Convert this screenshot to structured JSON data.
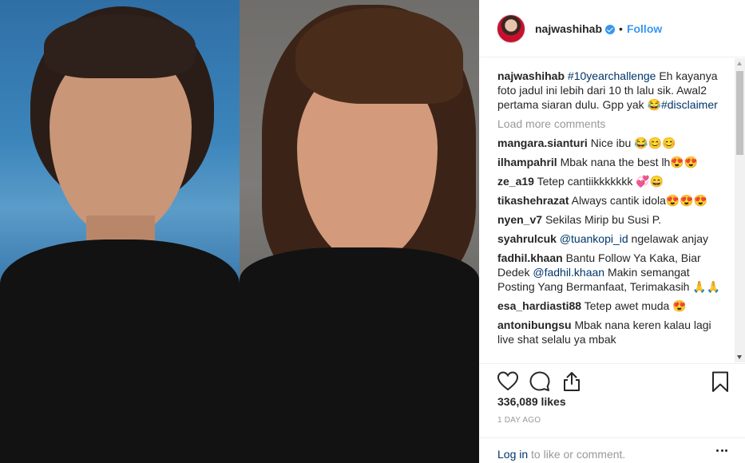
{
  "post": {
    "username": "najwashihab",
    "separator": "•",
    "follow_label": "Follow"
  },
  "caption": {
    "username": "najwashihab",
    "hashtag": "#10yearchallenge",
    "text": "Eh kayanya foto jadul ini lebih dari 10 th lalu sik. Awal2 pertama siaran dulu. Gpp yak 😂",
    "hashtag2": "#disclaimer"
  },
  "load_more_label": "Load more comments",
  "comments": [
    {
      "user": "mangara.sianturi",
      "text": "Nice ibu 😂😊😊"
    },
    {
      "user": "ilhampahril",
      "text": "Mbak nana the best lh😍😍"
    },
    {
      "user": "ze_a19",
      "text": "Tetep cantiikkkkkkk 💞😄"
    },
    {
      "user": "tikashehrazat",
      "text": "Always cantik idola😍😍😍"
    },
    {
      "user": "nyen_v7",
      "text": "Sekilas Mirip bu Susi P."
    },
    {
      "user": "syahrulcuk",
      "mention": "@tuankopi_id",
      "text": "ngelawak anjay"
    },
    {
      "user": "fadhil.khaan",
      "text": "Bantu Follow Ya Kaka, Biar Dedek",
      "mention": "@fadhil.khaan",
      "text2": "Makin semangat Posting Yang Bermanfaat, Terimakasih 🙏🙏"
    },
    {
      "user": "esa_hardiasti88",
      "text": "Tetep awet muda 😍"
    },
    {
      "user": "antonibungsu",
      "text": "Mbak nana keren kalau lagi live shat selalu ya mbak"
    }
  ],
  "likes": "336,089 likes",
  "timestamp": "1 DAY AGO",
  "login": {
    "link": "Log in",
    "text": "to like or comment."
  },
  "icons": {
    "like": "heart-icon",
    "comment": "comment-bubble-icon",
    "share": "share-icon",
    "save": "bookmark-icon",
    "more": "more-options-icon",
    "verified": "verified-badge-icon"
  },
  "colors": {
    "accent": "#3897f0",
    "link": "#003569",
    "muted": "#999999",
    "text": "#262626"
  }
}
